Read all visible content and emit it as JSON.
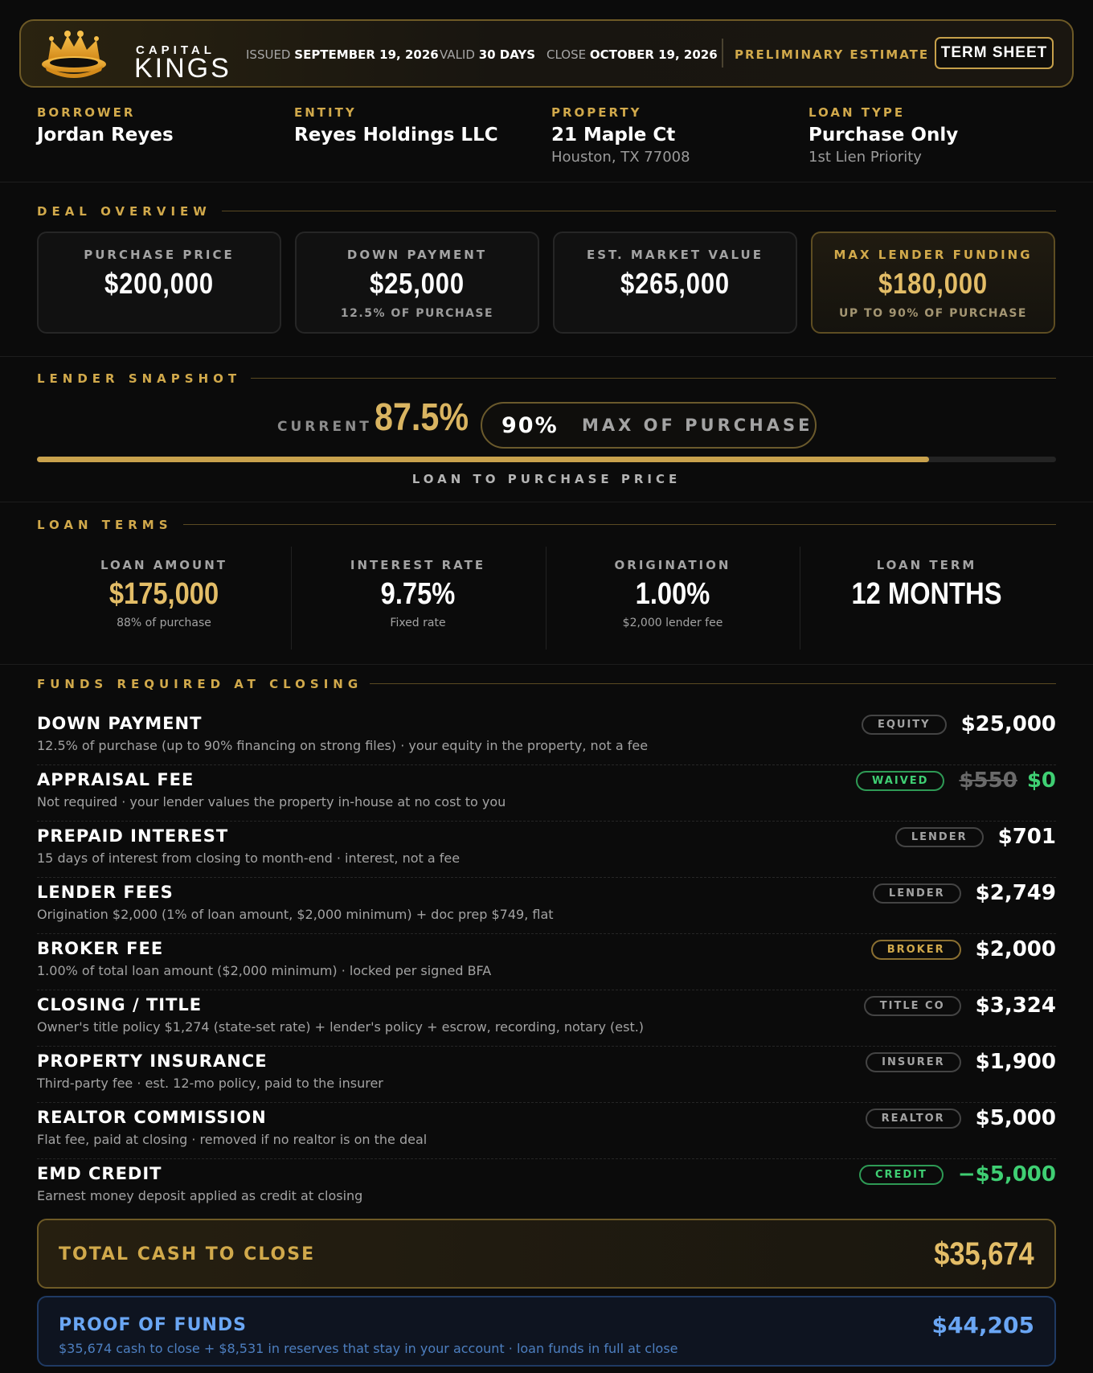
{
  "header": {
    "brand_top": "CAPITAL",
    "brand_main": "KINGS",
    "issued_label": "ISSUED",
    "issued_value": "SEPTEMBER 19, 2026",
    "valid_label": "VALID",
    "valid_value": "30 DAYS",
    "close_label": "CLOSE",
    "close_value": "OCTOBER 19, 2026",
    "status": "PRELIMINARY ESTIMATE",
    "term_sheet_button": "TERM SHEET"
  },
  "info": [
    {
      "label": "BORROWER",
      "value": "Jordan Reyes",
      "sub": ""
    },
    {
      "label": "ENTITY",
      "value": "Reyes Holdings LLC",
      "sub": ""
    },
    {
      "label": "PROPERTY",
      "value": "21 Maple Ct",
      "sub": "Houston, TX 77008"
    },
    {
      "label": "LOAN TYPE",
      "value": "Purchase Only",
      "sub": "1st Lien Priority"
    }
  ],
  "deal_overview": {
    "title": "DEAL OVERVIEW",
    "cards": [
      {
        "label": "PURCHASE PRICE",
        "value": "$200,000",
        "sub": ""
      },
      {
        "label": "DOWN PAYMENT",
        "value": "$25,000",
        "sub": "12.5% OF PURCHASE"
      },
      {
        "label": "EST. MARKET VALUE",
        "value": "$265,000",
        "sub": ""
      },
      {
        "label": "MAX LENDER FUNDING",
        "value": "$180,000",
        "sub": "UP TO 90% OF PURCHASE"
      }
    ]
  },
  "lender_snapshot": {
    "title": "LENDER SNAPSHOT",
    "current_label": "CURRENT",
    "current_value": "87.5%",
    "max_value": "90%",
    "max_label": "MAX OF PURCHASE",
    "progress_fraction": 0.875,
    "caption": "LOAN TO PURCHASE PRICE"
  },
  "loan_terms": {
    "title": "LOAN TERMS",
    "items": [
      {
        "label": "LOAN AMOUNT",
        "value": "$175,000",
        "sub": "88% of purchase"
      },
      {
        "label": "INTEREST RATE",
        "value": "9.75%",
        "sub": "Fixed rate"
      },
      {
        "label": "ORIGINATION",
        "value": "1.00%",
        "sub": "$2,000 lender fee"
      },
      {
        "label": "LOAN TERM",
        "value": "12 MONTHS",
        "sub": ""
      }
    ]
  },
  "funds": {
    "title": "FUNDS REQUIRED AT CLOSING",
    "rows": [
      {
        "name": "DOWN PAYMENT",
        "desc": "12.5% of purchase (up to 90% financing on strong files) · your equity in the property, not a fee",
        "tag": "EQUITY",
        "amount": "$25,000",
        "original": ""
      },
      {
        "name": "APPRAISAL FEE",
        "desc": "Not required · your lender values the property in-house at no cost to you",
        "tag": "WAIVED",
        "amount": "$0",
        "original": "$550"
      },
      {
        "name": "PREPAID INTEREST",
        "desc": "15 days of interest from closing to month-end · interest, not a fee",
        "tag": "LENDER",
        "amount": "$701",
        "original": ""
      },
      {
        "name": "LENDER FEES",
        "desc": "Origination $2,000 (1% of loan amount, $2,000 minimum) + doc prep $749, flat",
        "tag": "LENDER",
        "amount": "$2,749",
        "original": ""
      },
      {
        "name": "BROKER FEE",
        "desc": "1.00% of total loan amount ($2,000 minimum) · locked per signed BFA",
        "tag": "BROKER",
        "amount": "$2,000",
        "original": ""
      },
      {
        "name": "CLOSING / TITLE",
        "desc": "Owner's title policy $1,274 (state-set rate) + lender's policy + escrow, recording, notary (est.)",
        "tag": "TITLE CO",
        "amount": "$3,324",
        "original": ""
      },
      {
        "name": "PROPERTY INSURANCE",
        "desc": "Third-party fee · est. 12-mo policy, paid to the insurer",
        "tag": "INSURER",
        "amount": "$1,900",
        "original": ""
      },
      {
        "name": "REALTOR COMMISSION",
        "desc": "Flat fee, paid at closing · removed if no realtor is on the deal",
        "tag": "REALTOR",
        "amount": "$5,000",
        "original": ""
      },
      {
        "name": "EMD CREDIT",
        "desc": "Earnest money deposit applied as credit at closing",
        "tag": "CREDIT",
        "amount": "−$5,000",
        "original": ""
      }
    ]
  },
  "total": {
    "label": "TOTAL CASH TO CLOSE",
    "value": "$35,674"
  },
  "proof_of_funds": {
    "label": "PROOF OF FUNDS",
    "sub": "$35,674 cash to close + $8,531 in reserves that stay in your account · loan funds in full at close",
    "value": "$44,205"
  },
  "colors": {
    "gold": "#d1a94b",
    "green": "#3fcf73",
    "blue": "#6aa6f4",
    "background": "#0b0b0b"
  },
  "icons": {
    "logo": "crown-icon"
  }
}
